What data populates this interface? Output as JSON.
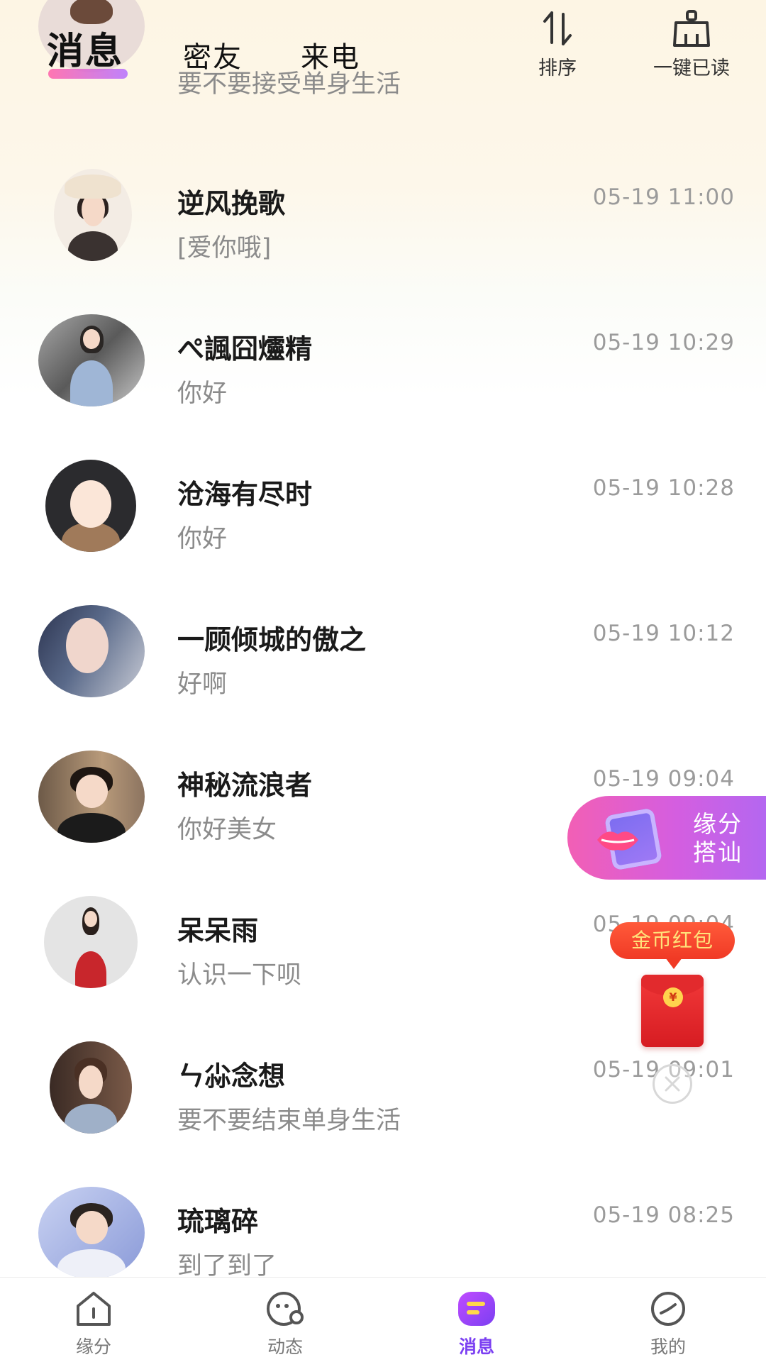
{
  "header": {
    "tabs": [
      {
        "label": "消息",
        "active": true
      },
      {
        "label": "密友",
        "active": false
      },
      {
        "label": "来电",
        "active": false
      }
    ],
    "sort_label": "排序",
    "sort_icon": "sort-arrows-icon",
    "mark_read_label": "一键已读",
    "mark_read_icon": "broom-icon"
  },
  "conversations": [
    {
      "name": "",
      "message": "要不要接受单身生活",
      "time": "",
      "partial": true
    },
    {
      "name": "逆风挽歌",
      "message": "[爱你哦]",
      "time": "05-19 11:00"
    },
    {
      "name": "ぺ諷囧爧精",
      "message": "你好",
      "time": "05-19 10:29"
    },
    {
      "name": "沧海有尽时",
      "message": "你好",
      "time": "05-19 10:28"
    },
    {
      "name": "一顾倾城的傲之",
      "message": "好啊",
      "time": "05-19 10:12"
    },
    {
      "name": "神秘流浪者",
      "message": "你好美女",
      "time": "05-19 09:04"
    },
    {
      "name": "呆呆雨",
      "message": "认识一下呗",
      "time": "05-19 09:04"
    },
    {
      "name": "ㄣ尛念想",
      "message": "要不要结束单身生活",
      "time": "05-19 09:01"
    },
    {
      "name": "琉璃碎",
      "message": "到了到了",
      "time": "05-19 08:25"
    }
  ],
  "match_float": {
    "line1": "缘分",
    "line2": "搭讪",
    "icon": "phone-lips-icon"
  },
  "coin_envelope": {
    "tip": "金币红包",
    "coin_symbol": "¥"
  },
  "bottom_nav": [
    {
      "label": "缘分",
      "icon": "home-icon",
      "active": false
    },
    {
      "label": "动态",
      "icon": "feed-icon",
      "active": false
    },
    {
      "label": "消息",
      "icon": "message-icon",
      "active": true
    },
    {
      "label": "我的",
      "icon": "profile-icon",
      "active": false
    }
  ],
  "colors": {
    "accent_purple": "#7b3ff2",
    "accent_pink": "#f25fb5",
    "coin_red": "#f03a25",
    "time_gray": "#9b9b9b"
  }
}
